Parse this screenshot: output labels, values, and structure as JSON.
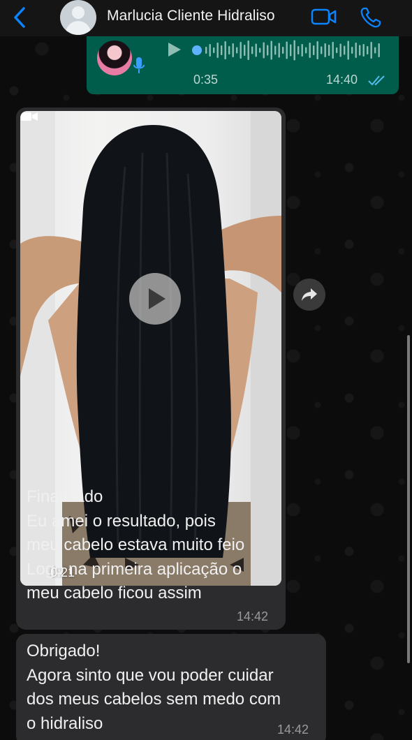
{
  "header": {
    "contact_name": "Marlucia Cliente Hidraliso",
    "icons": {
      "back": "chevron-left-icon",
      "avatar": "default-avatar-icon",
      "video_call": "video-camera-icon",
      "voice_call": "phone-icon"
    },
    "accent_color": "#0a84ff"
  },
  "messages": [
    {
      "type": "audio",
      "direction": "outgoing",
      "duration": "0:35",
      "time": "14:40",
      "status": "read",
      "bubble_color": "#005c4b"
    },
    {
      "type": "video",
      "direction": "incoming",
      "video_duration": "0:21",
      "text": "Finalizado\nEu amei o resultado, pois\nmeu cabelo estava muito feio\nLogo na primeira aplicação o\nmeu cabelo ficou assim",
      "time": "14:42",
      "bubble_color": "#2c2c2e"
    },
    {
      "type": "text",
      "direction": "incoming",
      "text": "Obrigado!\nAgora sinto que vou poder cuidar\ndos meus cabelos sem medo com\no hidraliso",
      "time": "14:42",
      "bubble_color": "#2c2c2e"
    }
  ],
  "forward_icon": "forward-arrow-icon"
}
